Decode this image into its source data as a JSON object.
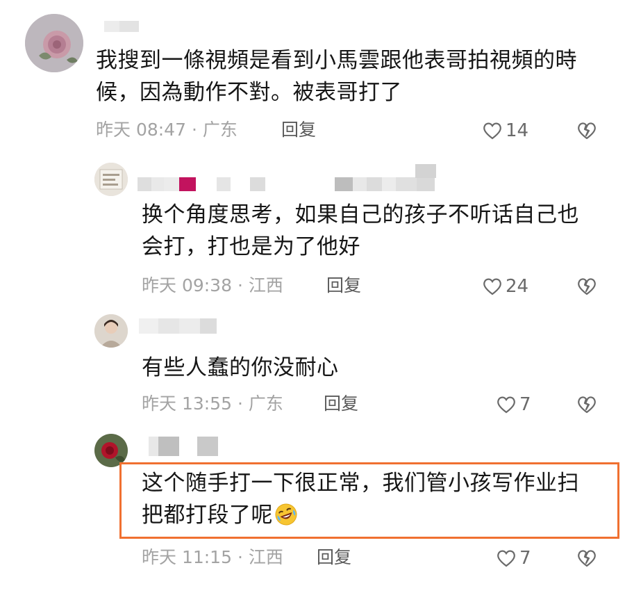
{
  "comments": [
    {
      "text": "我搜到一條視頻是看到小馬雲跟他表哥拍視頻的時候，因為動作不對。被表哥打了",
      "time_location": "昨天 08:47 · 广东",
      "reply_label": "回复",
      "likes": "14"
    },
    {
      "text": "换个角度思考，如果自己的孩子不听话自己也会打，打也是为了他好",
      "time_location": "昨天 09:38 · 江西",
      "reply_label": "回复",
      "likes": "24"
    },
    {
      "text": "有些人蠢的你没耐心",
      "time_location": "昨天 13:55 · 广东",
      "reply_label": "回复",
      "likes": "7"
    },
    {
      "text": "这个随手打一下很正常，我们管小孩写作业扫把都打段了呢",
      "time_location": "昨天 11:15 · 江西",
      "reply_label": "回复",
      "likes": "7"
    }
  ],
  "icons": {
    "like": "heart-outline-icon",
    "dislike": "broken-heart-icon",
    "emoji": "rofl-emoji-icon"
  },
  "colors": {
    "highlight_border": "#f07030",
    "meta_text": "#a3a3a3",
    "body_text": "#161616"
  }
}
